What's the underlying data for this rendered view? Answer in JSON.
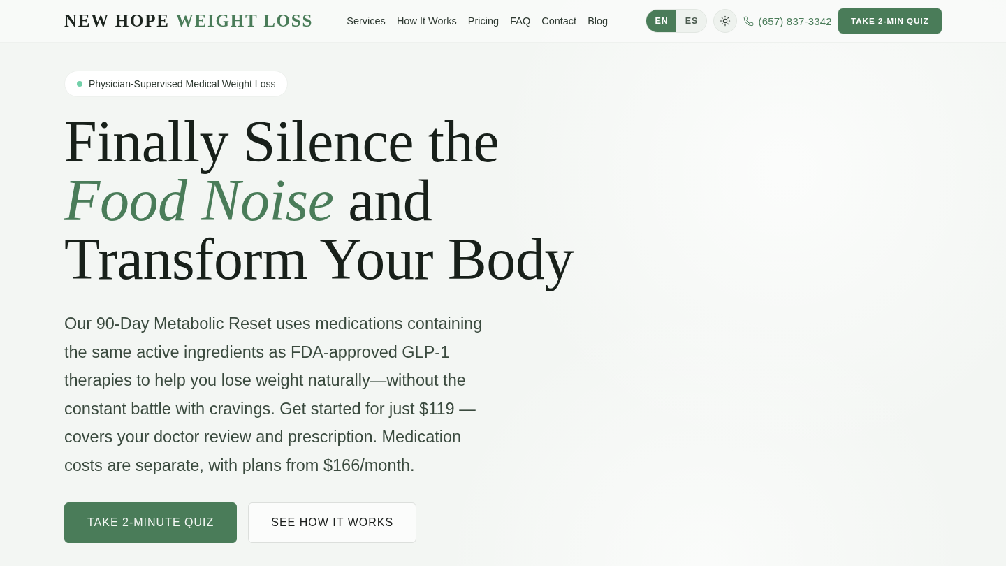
{
  "header": {
    "logo": {
      "first": "NEW HOPE",
      "second": "WEIGHT LOSS"
    },
    "nav": [
      "Services",
      "How It Works",
      "Pricing",
      "FAQ",
      "Contact",
      "Blog"
    ],
    "languages": [
      {
        "label": "EN",
        "selected": true
      },
      {
        "label": "ES",
        "selected": false
      }
    ],
    "phone": "(657) 837-3342",
    "cta": "TAKE 2-MIN QUIZ"
  },
  "hero": {
    "badge": {
      "text": "Physician-Supervised Medical Weight Loss",
      "color": "#72d0a9"
    },
    "headline": "Finally Silence the *Food Noise* and Transform Your Body",
    "description": "Our 90-Day Metabolic Reset uses medications containing the same active ingredients as FDA-approved GLP-1 therapies to help you lose weight naturally—without the constant battle with cravings. Get started for just $119 — covers your doctor review and prescription. Medication costs are separate, with plans from $166/month.",
    "buttons": [
      {
        "label": "TAKE 2-MINUTE QUIZ",
        "kind": "primary"
      },
      {
        "label": "SEE HOW IT WORKS",
        "kind": "secondary"
      }
    ]
  }
}
